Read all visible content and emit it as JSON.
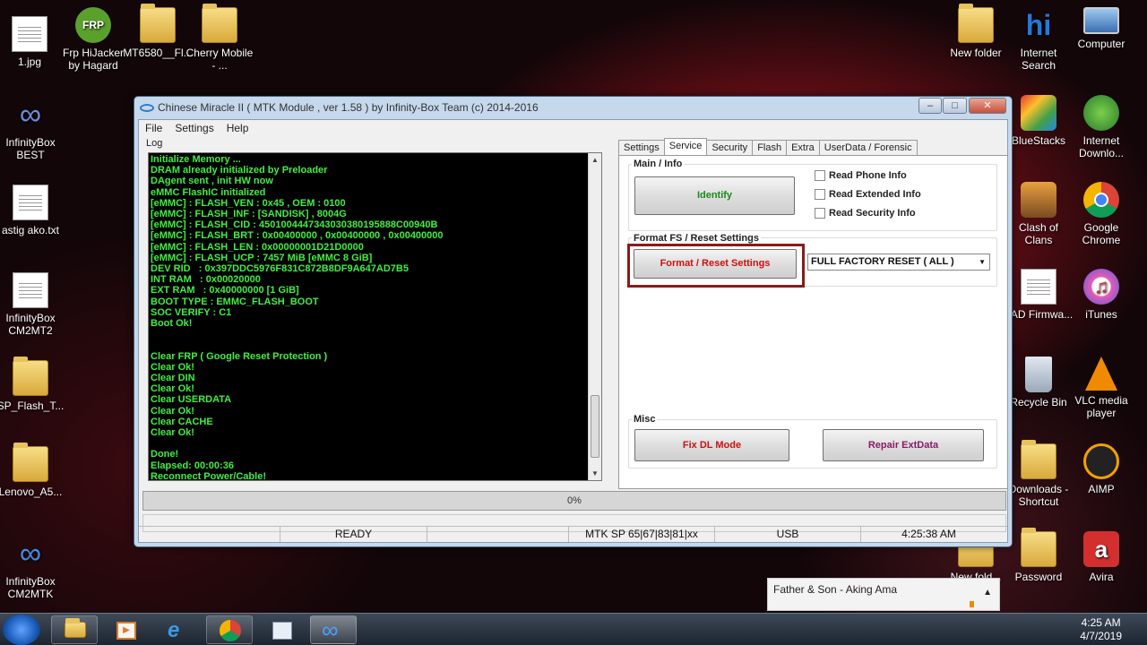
{
  "desktop_icons": [
    {
      "label": "1.jpg"
    },
    {
      "label": "Frp HiJacker by Hagard"
    },
    {
      "label": "MT6580__Fl..."
    },
    {
      "label": "Cherry Mobile - ..."
    },
    {
      "label": "InfinityBox BEST"
    },
    {
      "label": "astig ako.txt"
    },
    {
      "label": "InfinityBox CM2MT2"
    },
    {
      "label": "SP_Flash_T..."
    },
    {
      "label": "Lenovo_A5..."
    },
    {
      "label": "InfinityBox CM2MTK"
    },
    {
      "label": "New folder"
    },
    {
      "label": "Internet Search"
    },
    {
      "label": "Computer"
    },
    {
      "label": "BlueStacks"
    },
    {
      "label": "Internet Downlo..."
    },
    {
      "label": "Clash of Clans"
    },
    {
      "label": "Google Chrome"
    },
    {
      "label": "PAD Firmwa..."
    },
    {
      "label": "iTunes"
    },
    {
      "label": "Recycle Bin"
    },
    {
      "label": "VLC media player"
    },
    {
      "label": "Downloads - Shortcut"
    },
    {
      "label": "AIMP"
    },
    {
      "label": "Password"
    },
    {
      "label": "Avira"
    },
    {
      "label": "New fold..."
    }
  ],
  "window": {
    "title": "Chinese Miracle II ( MTK Module , ver 1.58 ) by Infinity-Box Team (c) 2014-2016",
    "menu": [
      "File",
      "Settings",
      "Help"
    ],
    "log_label": "Log",
    "log_lines": [
      "Initialize Memory ...",
      "DRAM already initialized by Preloader",
      "DAgent sent , init HW now",
      "eMMC FlashIC initialized",
      "[eMMC] : FLASH_VEN : 0x45 , OEM : 0100",
      "[eMMC] : FLASH_INF : [SANDISK] , 8004G",
      "[eMMC] : FLASH_CID : 4501004447343030380195888C00940B",
      "[eMMC] : FLASH_BRT : 0x00400000 , 0x00400000 , 0x00400000",
      "[eMMC] : FLASH_LEN : 0x00000001D21D0000",
      "[eMMC] : FLASH_UCP : 7457 MiB [eMMC 8 GiB]",
      "DEV RID   : 0x397DDC5976F831C872B8DF9A647AD7B5",
      "INT RAM   : 0x00020000",
      "EXT RAM   : 0x40000000 [1 GiB]",
      "BOOT TYPE : EMMC_FLASH_BOOT",
      "SOC VERIFY : C1",
      "Boot Ok!",
      "",
      "",
      "Clear FRP ( Google Reset Protection )",
      "Clear Ok!",
      "Clear DIN",
      "Clear Ok!",
      "Clear USERDATA",
      "Clear Ok!",
      "Clear CACHE",
      "Clear Ok!",
      "",
      "Done!",
      "Elapsed: 00:00:36",
      "Reconnect Power/Cable!"
    ],
    "tabs": [
      "Settings",
      "Service",
      "Security",
      "Flash",
      "Extra",
      "UserData / Forensic"
    ],
    "active_tab": "Service",
    "main_info": {
      "group": "Main / Info",
      "identify": "Identify",
      "checks": [
        "Read Phone Info",
        "Read Extended Info",
        "Read Security Info"
      ]
    },
    "format": {
      "group": "Format FS / Reset Settings",
      "button": "Format / Reset Settings",
      "select_value": "FULL FACTORY RESET ( ALL )"
    },
    "misc": {
      "group": "Misc",
      "fix_dl": "Fix DL Mode",
      "repair": "Repair ExtData"
    },
    "progress": "0%",
    "status": {
      "ready": "READY",
      "sp": "MTK SP 65|67|83|81|xx",
      "port": "USB",
      "time": "4:25:38 AM"
    },
    "colors": {
      "log_text": "#3fef3f",
      "identify": "#1a8a1a",
      "format": "#d01010",
      "fix_dl": "#d01010",
      "repair": "#8a1a6a",
      "highlight": "#8b1a1a"
    }
  },
  "media_notification": "Father & Son - Aking Ama",
  "taskbar": {
    "time": "4:25 AM",
    "date": "4/7/2019"
  }
}
